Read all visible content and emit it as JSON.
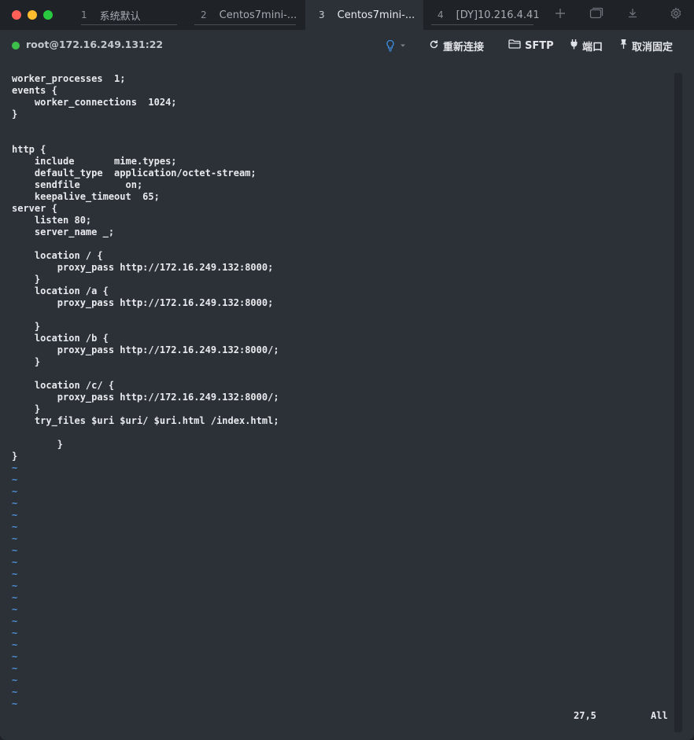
{
  "tabs": [
    {
      "num": "1",
      "label": "系统默认",
      "active": false
    },
    {
      "num": "2",
      "label": "Centos7mini-...",
      "active": false
    },
    {
      "num": "3",
      "label": "Centos7mini-...",
      "active": true
    },
    {
      "num": "4",
      "label": "[DY]10.216.4.41",
      "active": false
    }
  ],
  "tabbar_icons": [
    "plus-icon",
    "window-icon",
    "download-icon",
    "gear-icon"
  ],
  "connection": {
    "host": "root@172.16.249.131:22",
    "status_color": "#3dbe4a"
  },
  "toolbar": {
    "reconnect_label": "重新连接",
    "sftp_label": "SFTP",
    "port_label": "端口",
    "unpin_label": "取消固定"
  },
  "terminal": {
    "lines": [
      "worker_processes  1;",
      "events {",
      "    worker_connections  1024;",
      "}",
      "",
      "",
      "http {",
      "    include       mime.types;",
      "    default_type  application/octet-stream;",
      "    sendfile        on;",
      "    keepalive_timeout  65;",
      "server {",
      "    listen 80;",
      "    server_name _;",
      "",
      "    location / {",
      "        proxy_pass http://172.16.249.132:8000;",
      "    }",
      "    location /a {",
      "        proxy_pass http://172.16.249.132:8000;",
      "",
      "    }",
      "    location /b {",
      "        proxy_pass http://172.16.249.132:8000/;",
      "    }",
      "",
      "    location /c/ {",
      "        proxy_pass http://172.16.249.132:8000/;",
      "    }",
      "    try_files $uri $uri/ $uri.html /index.html;",
      "",
      "        }",
      "}"
    ],
    "tilde_rows": 21,
    "cursor_position": "27,5",
    "scroll_status": "All"
  }
}
